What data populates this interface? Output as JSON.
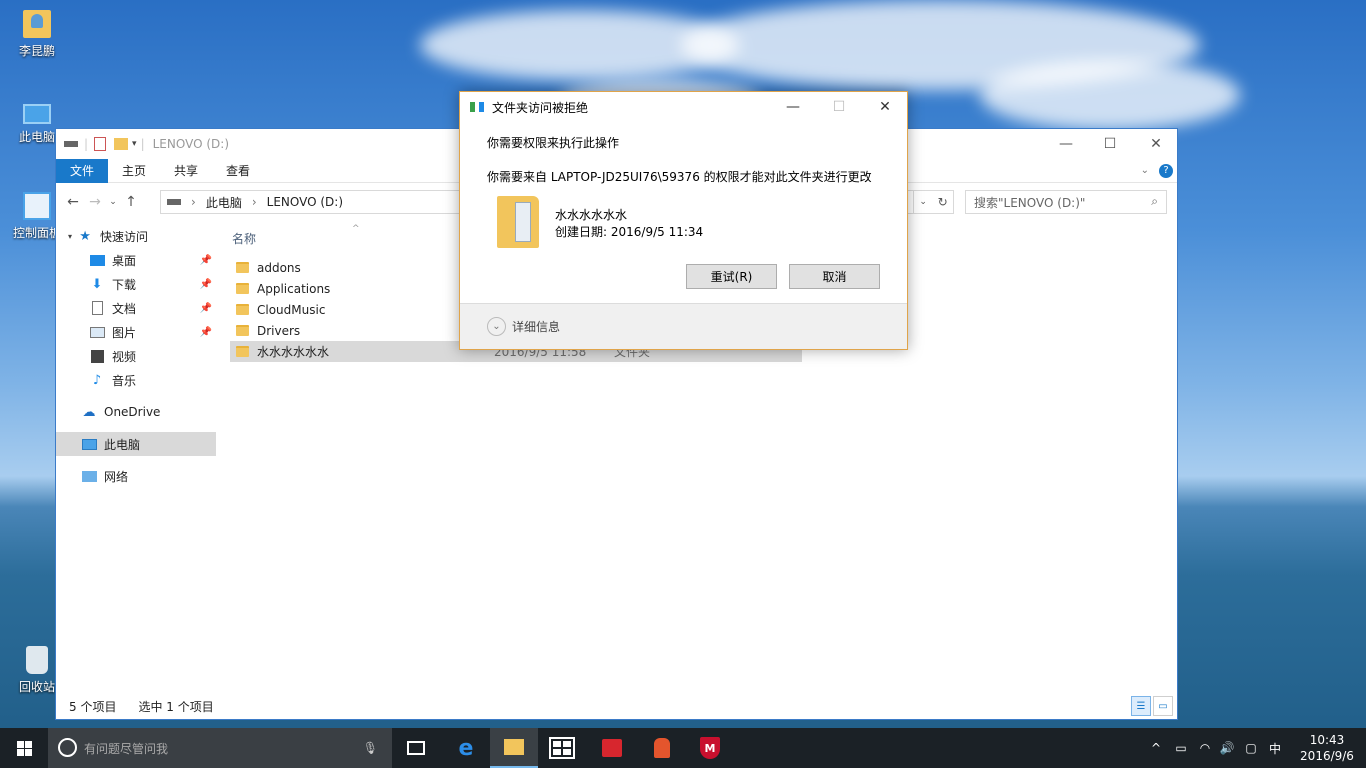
{
  "desktop": {
    "icons": [
      {
        "label": "李昆鹏"
      },
      {
        "label": "此电脑"
      },
      {
        "label": "控制面板"
      },
      {
        "label": "回收站"
      }
    ]
  },
  "explorer": {
    "title": "LENOVO (D:)",
    "ribbon_tabs": [
      "文件",
      "主页",
      "共享",
      "查看"
    ],
    "path": [
      "此电脑",
      "LENOVO (D:)"
    ],
    "search_placeholder": "搜索\"LENOVO (D:)\"",
    "column_name": "名称",
    "nav": {
      "quick_access": "快速访问",
      "items": [
        "桌面",
        "下载",
        "文档",
        "图片",
        "视频",
        "音乐"
      ],
      "onedrive": "OneDrive",
      "this_pc": "此电脑",
      "network": "网络"
    },
    "files": [
      {
        "name": "addons",
        "date": "",
        "type": ""
      },
      {
        "name": "Applications",
        "date": "",
        "type": ""
      },
      {
        "name": "CloudMusic",
        "date": "",
        "type": ""
      },
      {
        "name": "Drivers",
        "date": "",
        "type": ""
      },
      {
        "name": "水水水水水水",
        "date": "2016/9/5 11:58",
        "type": "文件夹"
      }
    ],
    "status": {
      "count": "5 个项目",
      "selected": "选中 1 个项目"
    }
  },
  "dialog": {
    "title": "文件夹访问被拒绝",
    "heading": "你需要权限来执行此操作",
    "message": "你需要来自 LAPTOP-JD25UI76\\59376 的权限才能对此文件夹进行更改",
    "folder_name": "水水水水水水",
    "created": "创建日期: 2016/9/5 11:34",
    "retry": "重试(R)",
    "cancel": "取消",
    "details": "详细信息"
  },
  "taskbar": {
    "search_placeholder": "有问题尽管问我",
    "ime": "中",
    "time": "10:43",
    "date": "2016/9/6"
  },
  "colors": {
    "accent": "#1979ca",
    "taskbar": "#1b2126",
    "dialog_border": "#e0a44a"
  }
}
